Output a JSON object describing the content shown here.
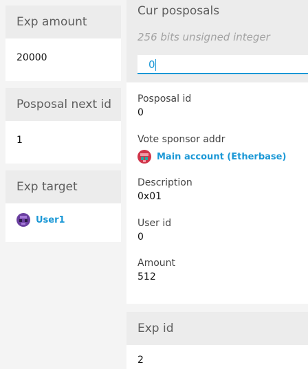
{
  "left": {
    "exp_amount": {
      "label": "Exp amount",
      "value": "20000"
    },
    "posposal_next_id": {
      "label": "Posposal next id",
      "value": "1"
    },
    "exp_target": {
      "label": "Exp target",
      "value": "User1",
      "avatar_icon": "identicon-purple"
    }
  },
  "right": {
    "cur_posposals": {
      "label": "Cur posposals",
      "hint": "256 bits unsigned integer",
      "input_value": "0",
      "fields": {
        "posposal_id": {
          "label": "Posposal id",
          "value": "0"
        },
        "vote_sponsor_addr": {
          "label": "Vote sponsor addr",
          "value": "Main account (Etherbase)",
          "avatar_icon": "identicon-red-teal"
        },
        "description": {
          "label": "Description",
          "value": "0x01"
        },
        "user_id": {
          "label": "User id",
          "value": "0"
        },
        "amount": {
          "label": "Amount",
          "value": "512"
        }
      }
    },
    "exp_id": {
      "label": "Exp id",
      "value": "2"
    }
  },
  "colors": {
    "accent": "#1b98d6",
    "header_bg": "#ececec",
    "page_bg": "#f4f4f4"
  }
}
